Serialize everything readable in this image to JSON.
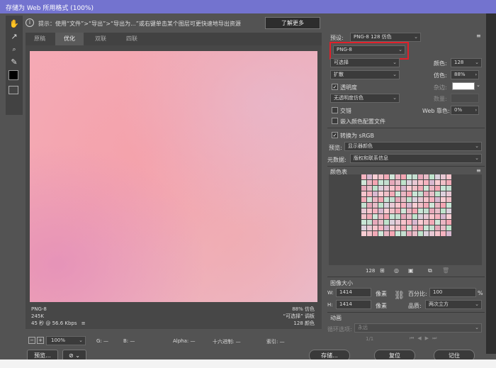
{
  "window": {
    "title": "存储为 Web 所用格式 (100%)"
  },
  "infobar": {
    "icon": "info-icon",
    "text": "提示：使用“文件”>“导出”>“导出为...”或右键单击某个图层可更快速地导出资源",
    "learn_more": "了解更多"
  },
  "tools": [
    {
      "name": "hand-tool-icon",
      "glyph": "✋"
    },
    {
      "name": "slice-select-icon",
      "glyph": "↗"
    },
    {
      "name": "zoom-icon",
      "glyph": "🔍"
    },
    {
      "name": "eyedropper-icon",
      "glyph": "✎"
    }
  ],
  "tabs": [
    {
      "label": "原稿",
      "active": false
    },
    {
      "label": "优化",
      "active": true
    },
    {
      "label": "双联",
      "active": false
    },
    {
      "label": "四联",
      "active": false
    }
  ],
  "preview_info": {
    "format": "PNG-8",
    "size": "245K",
    "time": "45 秒 @ 56.6 Kbps",
    "menu_icon": "≡",
    "dither": "88% 仿色",
    "palette": "“可选择” 调板",
    "colors": "128 颜色"
  },
  "statusbar": {
    "zoom": "100%",
    "g": "G: —",
    "b": "B: —",
    "alpha": "Alpha: —",
    "hex": "十六进制: —",
    "index": "索引: —"
  },
  "buttons": {
    "preview": "预览...",
    "save": "存储...",
    "reset": "复位",
    "remember": "记住"
  },
  "panel": {
    "preset_label": "预设:",
    "preset_value": "PNG-8 128 仿色",
    "format_value": "PNG-8",
    "reduction": "可选择",
    "dither_algo": "扩散",
    "colors_label": "颜色:",
    "colors_value": "128",
    "dither_label": "仿色:",
    "dither_value": "88%",
    "transparency_label": "透明度",
    "transparency_checked": true,
    "matte_label": "杂边:",
    "transparency_dither": "无透明度仿色",
    "amount_label": "数量:",
    "interlaced_label": "交错",
    "web_snap_label": "Web 靠色:",
    "web_snap_value": "0%",
    "embed_profile_label": "嵌入颜色配置文件",
    "convert_srgb_label": "转换为 sRGB",
    "convert_srgb_checked": true,
    "preview_label": "预览:",
    "preview_value": "显示器颜色",
    "metadata_label": "元数据:",
    "metadata_value": "版权和联系信息",
    "color_table_title": "颜色表",
    "color_count": "128",
    "image_size_title": "图像大小",
    "w_label": "W:",
    "w_value": "1414",
    "h_label": "H:",
    "h_value": "1414",
    "unit": "像素",
    "percent_label": "百分比:",
    "percent_value": "100",
    "percent_sign": "%",
    "quality_label": "品质:",
    "quality_value": "两次立方",
    "animation_title": "动画",
    "loop_label": "循环选项:",
    "loop_value": "永远",
    "frame_counter": "1/1"
  },
  "colors": {
    "title_bg": "#7373cf",
    "highlight": "#e0202a",
    "preview_pink": "#f3a7b0"
  }
}
